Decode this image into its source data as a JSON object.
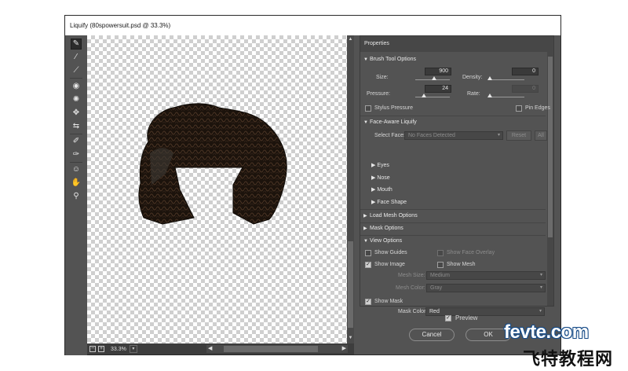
{
  "window": {
    "title": "Liquify (80spowersuit.psd @ 33.3%)"
  },
  "toolbar": {
    "tools": [
      {
        "name": "forward-warp-icon",
        "glyph": "✎"
      },
      {
        "name": "reconstruct-icon",
        "glyph": "⁄"
      },
      {
        "name": "smooth-icon",
        "glyph": "⟋"
      },
      {
        "name": "twirl-icon",
        "glyph": "◉"
      },
      {
        "name": "pucker-icon",
        "glyph": "✺"
      },
      {
        "name": "bloat-icon",
        "glyph": "✥"
      },
      {
        "name": "push-left-icon",
        "glyph": "⇆"
      },
      {
        "name": "freeze-mask-icon",
        "glyph": "✐"
      },
      {
        "name": "thaw-mask-icon",
        "glyph": "✑"
      },
      {
        "name": "face-tool-icon",
        "glyph": "☺"
      },
      {
        "name": "hand-icon",
        "glyph": "✋"
      },
      {
        "name": "zoom-icon",
        "glyph": "⚲"
      }
    ]
  },
  "status": {
    "zoom": "33.3%"
  },
  "panel": {
    "title": "Properties",
    "brush": {
      "header": "Brush Tool Options",
      "size_label": "Size:",
      "size_value": "900",
      "size_level": 0.55,
      "density_label": "Density:",
      "density_value": "0",
      "density_level": 0.0,
      "pressure_label": "Pressure:",
      "pressure_value": "24",
      "pressure_level": 0.24,
      "rate_label": "Rate:",
      "rate_value": "0",
      "rate_level": 0.0,
      "stylus_label": "Stylus Pressure",
      "pin_label": "Pin Edges"
    },
    "face": {
      "header": "Face-Aware Liquify",
      "select_label": "Select Face:",
      "select_value": "No Faces Detected",
      "reset_label": "Reset",
      "all_label": "All",
      "items": [
        "Eyes",
        "Nose",
        "Mouth",
        "Face Shape"
      ]
    },
    "load_mesh": "Load Mesh Options",
    "mask_options": "Mask Options",
    "view": {
      "header": "View Options",
      "show_guides": "Show Guides",
      "show_face_overlay": "Show Face Overlay",
      "show_image": "Show Image",
      "show_mesh": "Show Mesh",
      "mesh_size_label": "Mesh Size:",
      "mesh_size_value": "Medium",
      "mesh_color_label": "Mesh Color:",
      "mesh_color_value": "Gray",
      "show_mask": "Show Mask",
      "mask_color_label": "Mask Color:",
      "mask_color_value": "Red"
    }
  },
  "footer": {
    "preview_label": "Preview",
    "cancel_label": "Cancel",
    "ok_label": "OK"
  },
  "watermark": {
    "main": "fevte.com",
    "sub": "飞特教程网"
  }
}
